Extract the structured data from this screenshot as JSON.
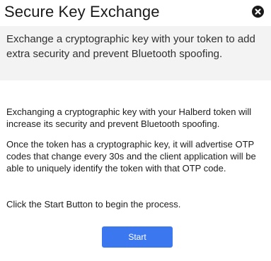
{
  "dialog": {
    "title": "Secure Key Exchange",
    "close_icon": "close-circle-icon",
    "subtitle": "Exchange a cryptographic key with your token to add extra security and prevent Bluetooth spoofing.",
    "paragraphs": [
      "Exchanging a cryptographic key with your Halberd token will increase its security and prevent Bluetooth spoofing.",
      "Once the token has a cryptographic key, it will advertise OTP codes that change every 30s and the client application will be able to uniquely identify the token with that OTP code.",
      "Click the Start Button to begin the process."
    ],
    "start_label": "Start"
  },
  "colors": {
    "header_background": "#f3f3f3",
    "accent": "#3b78f0",
    "text": "#1c1c1c"
  }
}
